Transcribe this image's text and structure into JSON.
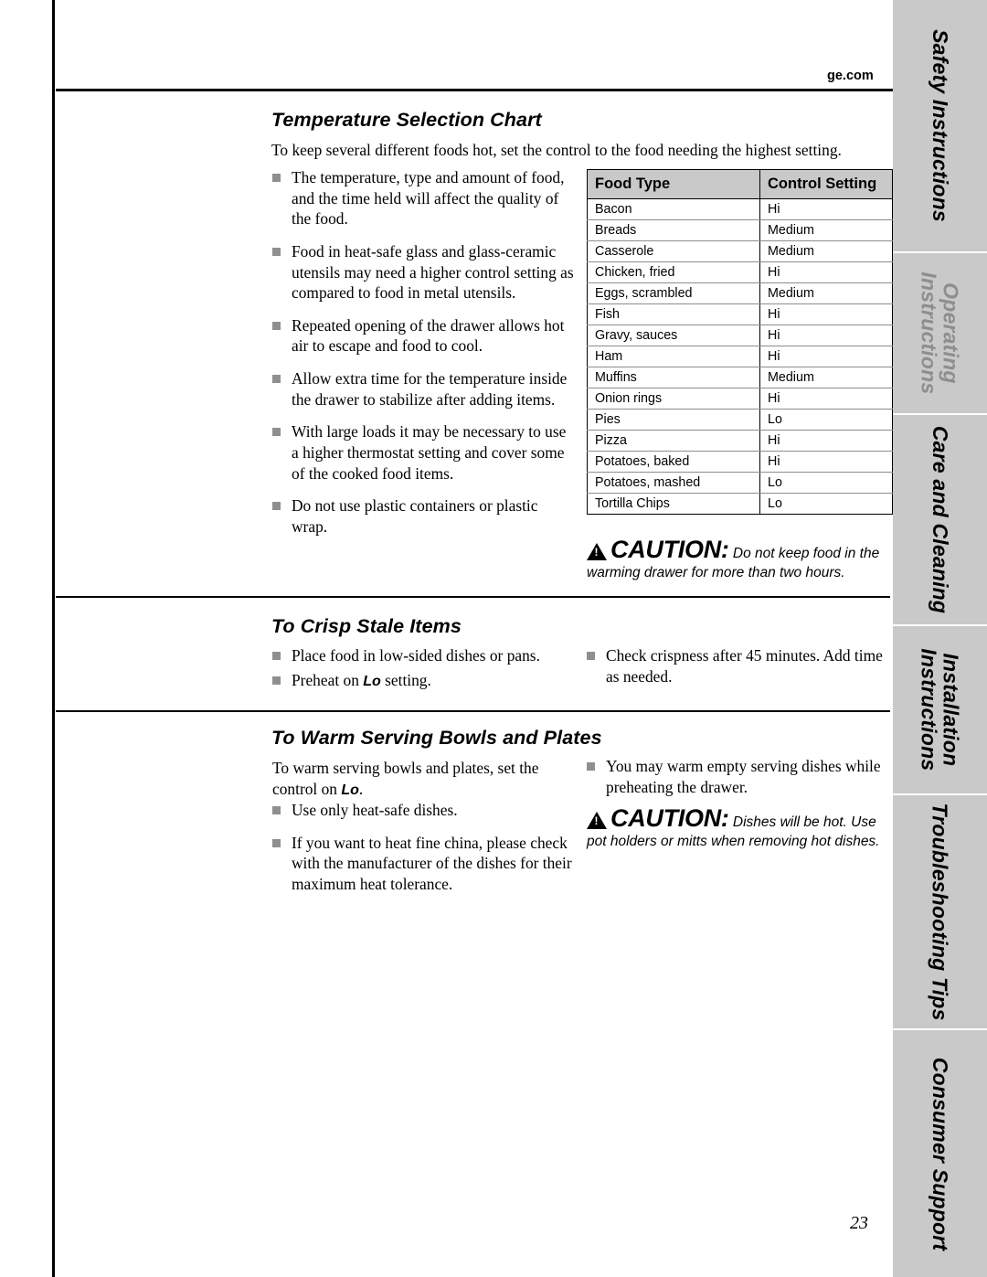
{
  "page": {
    "number": "23",
    "site": "ge.com"
  },
  "sections": {
    "temperature": {
      "title": "Temperature Selection Chart",
      "intro": "To keep several different foods hot, set the control to the food needing the highest setting.",
      "bullets": [
        "The temperature, type and amount of food, and the time held will affect the quality of the food.",
        "Food in heat-safe glass and glass-ceramic utensils may need a higher control setting as compared to food in metal utensils.",
        "Repeated opening of the drawer allows hot air to escape and food to cool.",
        "Allow extra time for the temperature inside the drawer to stabilize after adding items.",
        "With large loads it may be necessary to use a higher thermostat setting and cover some of the cooked food items.",
        "Do not use plastic containers or plastic wrap."
      ]
    },
    "crisp": {
      "title": "To Crisp Stale Items",
      "bullets_left_1": "Place food in low-sided dishes or pans.",
      "bullets_left_2_pre": "Preheat on ",
      "bullets_left_2_bold": "Lo",
      "bullets_left_2_post": " setting.",
      "bullets_right": [
        "Check crispness after 45 minutes. Add time as needed."
      ]
    },
    "warm": {
      "title": "To Warm Serving Bowls and Plates",
      "intro_pre": "To warm serving bowls and plates, set the control on ",
      "intro_bold": "Lo",
      "intro_post": ".",
      "bullets_left": [
        "Use only heat-safe dishes.",
        "If you want to heat fine china, please check with the manufacturer of the dishes for their maximum heat tolerance."
      ],
      "bullets_right": [
        "You may warm empty serving dishes while preheating the drawer."
      ]
    }
  },
  "cautions": [
    {
      "word": "CAUTION:",
      "text_inline": " Do not keep food in the",
      "text_rest": "warming drawer for more than two hours."
    },
    {
      "word": "CAUTION:",
      "text_inline": " Dishes will be hot. Use",
      "text_rest": "pot holders or mitts when removing hot dishes."
    }
  ],
  "table": {
    "headers": [
      "Food Type",
      "Control Setting"
    ],
    "rows": [
      [
        "Bacon",
        "Hi"
      ],
      [
        "Breads",
        "Medium"
      ],
      [
        "Casserole",
        "Medium"
      ],
      [
        "Chicken, fried",
        "Hi"
      ],
      [
        "Eggs, scrambled",
        "Medium"
      ],
      [
        "Fish",
        "Hi"
      ],
      [
        "Gravy, sauces",
        "Hi"
      ],
      [
        "Ham",
        "Hi"
      ],
      [
        "Muffins",
        "Medium"
      ],
      [
        "Onion rings",
        "Hi"
      ],
      [
        "Pies",
        "Lo"
      ],
      [
        "Pizza",
        "Hi"
      ],
      [
        "Potatoes, baked",
        "Hi"
      ],
      [
        "Potatoes, mashed",
        "Lo"
      ],
      [
        "Tortilla Chips",
        "Lo"
      ]
    ]
  },
  "side_tabs": [
    {
      "label": "Safety Instructions",
      "lines": [
        "Safety Instructions"
      ]
    },
    {
      "label": "Operating Instructions",
      "lines": [
        "Operating",
        "Instructions"
      ]
    },
    {
      "label": "Care and Cleaning",
      "lines": [
        "Care and Cleaning"
      ]
    },
    {
      "label": "Installation Instructions",
      "lines": [
        "Installation",
        "Instructions"
      ]
    },
    {
      "label": "Troubleshooting Tips",
      "lines": [
        "Troubleshooting Tips"
      ]
    },
    {
      "label": "Consumer Support",
      "lines": [
        "Consumer Support"
      ]
    }
  ]
}
